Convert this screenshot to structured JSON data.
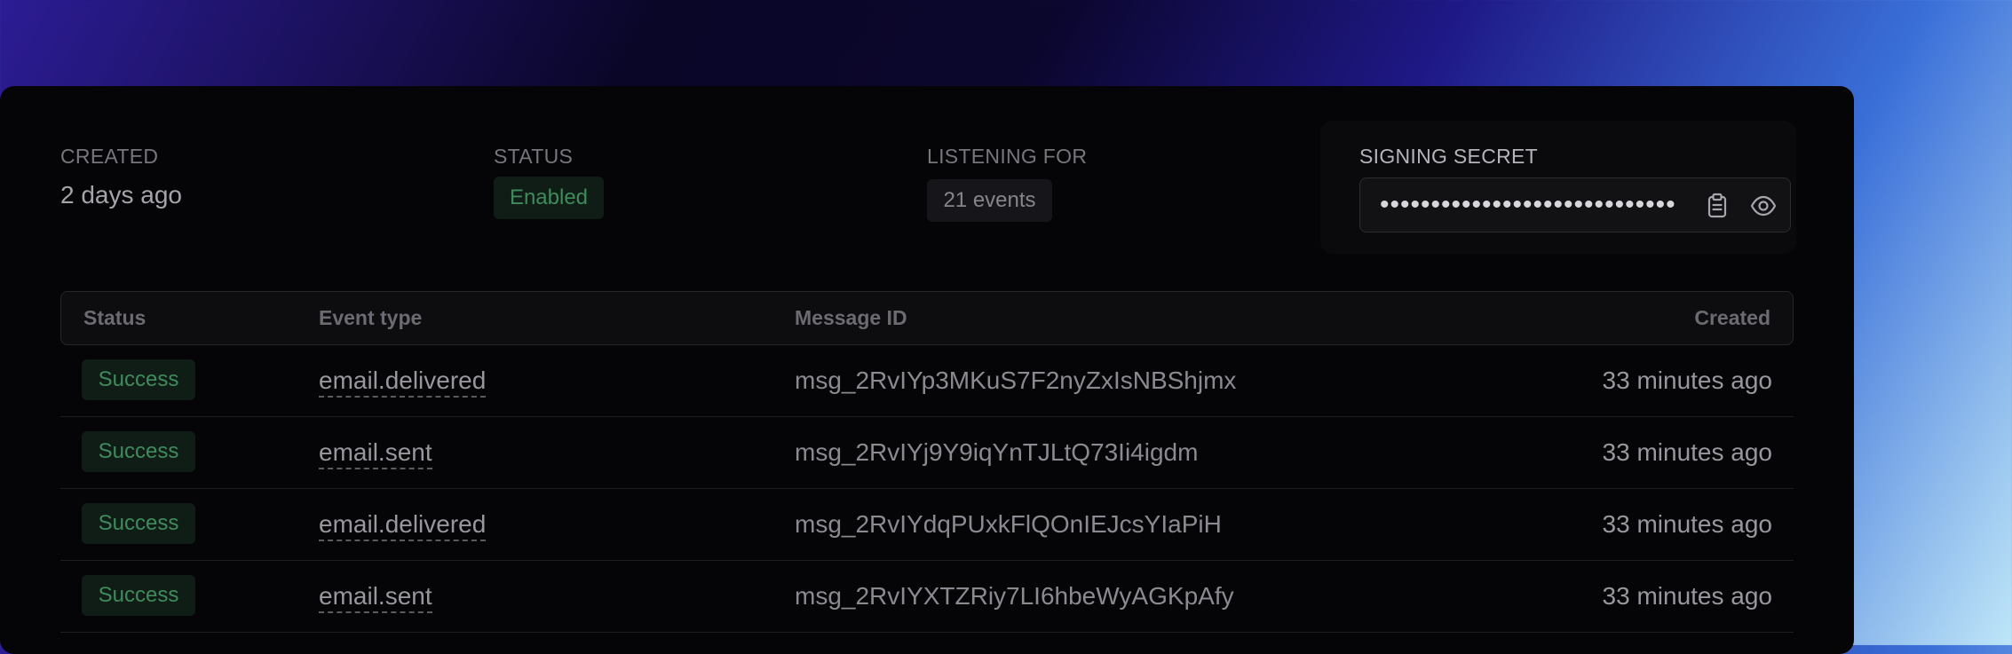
{
  "meta": {
    "created": {
      "label": "CREATED",
      "value": "2 days ago"
    },
    "status": {
      "label": "STATUS",
      "value": "Enabled"
    },
    "listening": {
      "label": "LISTENING FOR",
      "value": "21 events"
    },
    "secret": {
      "label": "SIGNING SECRET",
      "masked": "•••••••••••••••••••••••••••••••"
    }
  },
  "icons": {
    "copy": "clipboard-icon",
    "reveal": "eye-icon"
  },
  "colors": {
    "success_bg": "#0f1d16",
    "success_text": "#3f8b5c"
  },
  "table": {
    "headers": [
      "Status",
      "Event type",
      "Message ID",
      "Created"
    ],
    "rows": [
      {
        "status": "Success",
        "event": "email.delivered",
        "message_id": "msg_2RvIYp3MKuS7F2nyZxIsNBShjmx",
        "created": "33 minutes ago"
      },
      {
        "status": "Success",
        "event": "email.sent",
        "message_id": "msg_2RvIYj9Y9iqYnTJLtQ73Ii4igdm",
        "created": "33 minutes ago"
      },
      {
        "status": "Success",
        "event": "email.delivered",
        "message_id": "msg_2RvIYdqPUxkFlQOnIEJcsYIaPiH",
        "created": "33 minutes ago"
      },
      {
        "status": "Success",
        "event": "email.sent",
        "message_id": "msg_2RvIYXTZRiy7LI6hbeWyAGKpAfy",
        "created": "33 minutes ago"
      }
    ]
  }
}
